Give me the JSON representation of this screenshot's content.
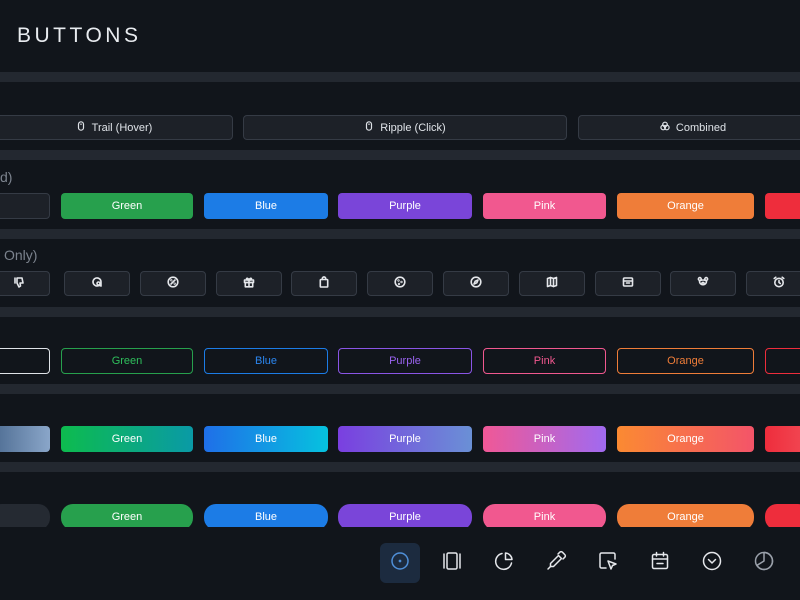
{
  "page": {
    "title": "BUTTONS"
  },
  "modes": [
    {
      "label": "Trail (Hover)",
      "icon": "mouse-icon"
    },
    {
      "label": "Ripple (Click)",
      "icon": "mouse-icon"
    },
    {
      "label": "Combined",
      "icon": "combined-icon"
    }
  ],
  "sections": {
    "solid": {
      "label": "d)"
    },
    "icon_only": {
      "label": "Only)"
    }
  },
  "colors": {
    "green": "#27a04d",
    "blue": "#1c7ce6",
    "purple": "#7a45d9",
    "pink": "#f1588f",
    "orange": "#ef7d39",
    "red": "#ee2d3c"
  },
  "solid_buttons": [
    "Green",
    "Blue",
    "Purple",
    "Pink",
    "Orange"
  ],
  "outline_buttons": [
    "Green",
    "Blue",
    "Purple",
    "Pink",
    "Orange"
  ],
  "gradient_buttons": [
    "Green",
    "Blue",
    "Purple",
    "Pink",
    "Orange"
  ],
  "pill_buttons": [
    "Green",
    "Blue",
    "Purple",
    "Pink",
    "Orange"
  ],
  "icon_buttons": [
    "thumbs-down-icon",
    "search-chat-icon",
    "percent-badge-icon",
    "gift-icon",
    "shopping-bag-icon",
    "cookie-icon",
    "compass-icon",
    "map-icon",
    "archive-box-icon",
    "bear-icon",
    "alarm-clock-icon"
  ],
  "dock": [
    "target-icon",
    "columns-icon",
    "pie-chart-icon",
    "color-picker-icon",
    "cursor-select-icon",
    "calendar-icon",
    "chevron-circle-icon",
    "moon-half-icon"
  ]
}
